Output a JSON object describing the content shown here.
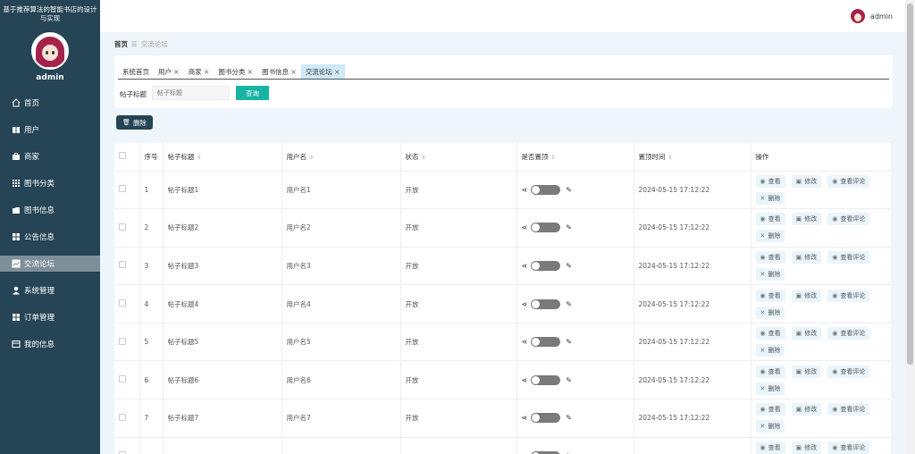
{
  "sidebar": {
    "app_title": "基于推荐算法的智能书店的设计与实现",
    "user_name": "admin",
    "items": [
      {
        "label": "首页",
        "icon": "home-icon"
      },
      {
        "label": "用户",
        "icon": "book-icon"
      },
      {
        "label": "商家",
        "icon": "briefcase-icon"
      },
      {
        "label": "图书分类",
        "icon": "grid-icon"
      },
      {
        "label": "图书信息",
        "icon": "folder-icon"
      },
      {
        "label": "公告信息",
        "icon": "grid-icon"
      },
      {
        "label": "交流论坛",
        "icon": "chart-icon"
      },
      {
        "label": "系统管理",
        "icon": "user-icon"
      },
      {
        "label": "订单管理",
        "icon": "grid-icon"
      },
      {
        "label": "我的信息",
        "icon": "window-icon"
      }
    ],
    "active_item": "交流论坛"
  },
  "header": {
    "user_name": "admin"
  },
  "breadcrumb": {
    "home": "首页",
    "current": "交流论坛"
  },
  "tabs": [
    {
      "label": "系统首页",
      "closable": false
    },
    {
      "label": "用户",
      "closable": true
    },
    {
      "label": "商家",
      "closable": true
    },
    {
      "label": "图书分类",
      "closable": true
    },
    {
      "label": "图书信息",
      "closable": true
    },
    {
      "label": "交流论坛",
      "closable": true,
      "active": true
    }
  ],
  "search": {
    "label": "帖子标题",
    "placeholder": "帖子标题",
    "button": "查询"
  },
  "toolbar": {
    "delete_label": "删除"
  },
  "table": {
    "columns": [
      "序号",
      "帖子标题",
      "用户名",
      "状态",
      "是否置顶",
      "置顶时间",
      "操作"
    ],
    "actions": [
      "查看",
      "修改",
      "查看评论",
      "删除"
    ],
    "rows": [
      {
        "index": "1",
        "title": "帖子标题1",
        "username": "用户名1",
        "status": "开放",
        "time": "2024-05-15 17:12:22"
      },
      {
        "index": "2",
        "title": "帖子标题2",
        "username": "用户名2",
        "status": "开放",
        "time": "2024-05-15 17:12:22"
      },
      {
        "index": "3",
        "title": "帖子标题3",
        "username": "用户名3",
        "status": "开放",
        "time": "2024-05-15 17:12:22"
      },
      {
        "index": "4",
        "title": "帖子标题4",
        "username": "用户名4",
        "status": "开放",
        "time": "2024-05-15 17:12:22"
      },
      {
        "index": "5",
        "title": "帖子标题5",
        "username": "用户名5",
        "status": "开放",
        "time": "2024-05-15 17:12:22"
      },
      {
        "index": "6",
        "title": "帖子标题6",
        "username": "用户名6",
        "status": "开放",
        "time": "2024-05-15 17:12:22"
      },
      {
        "index": "7",
        "title": "帖子标题7",
        "username": "用户名7",
        "status": "开放",
        "time": "2024-05-15 17:12:22"
      },
      {
        "index": "",
        "title": "",
        "username": "",
        "status": "",
        "time": ""
      }
    ]
  }
}
